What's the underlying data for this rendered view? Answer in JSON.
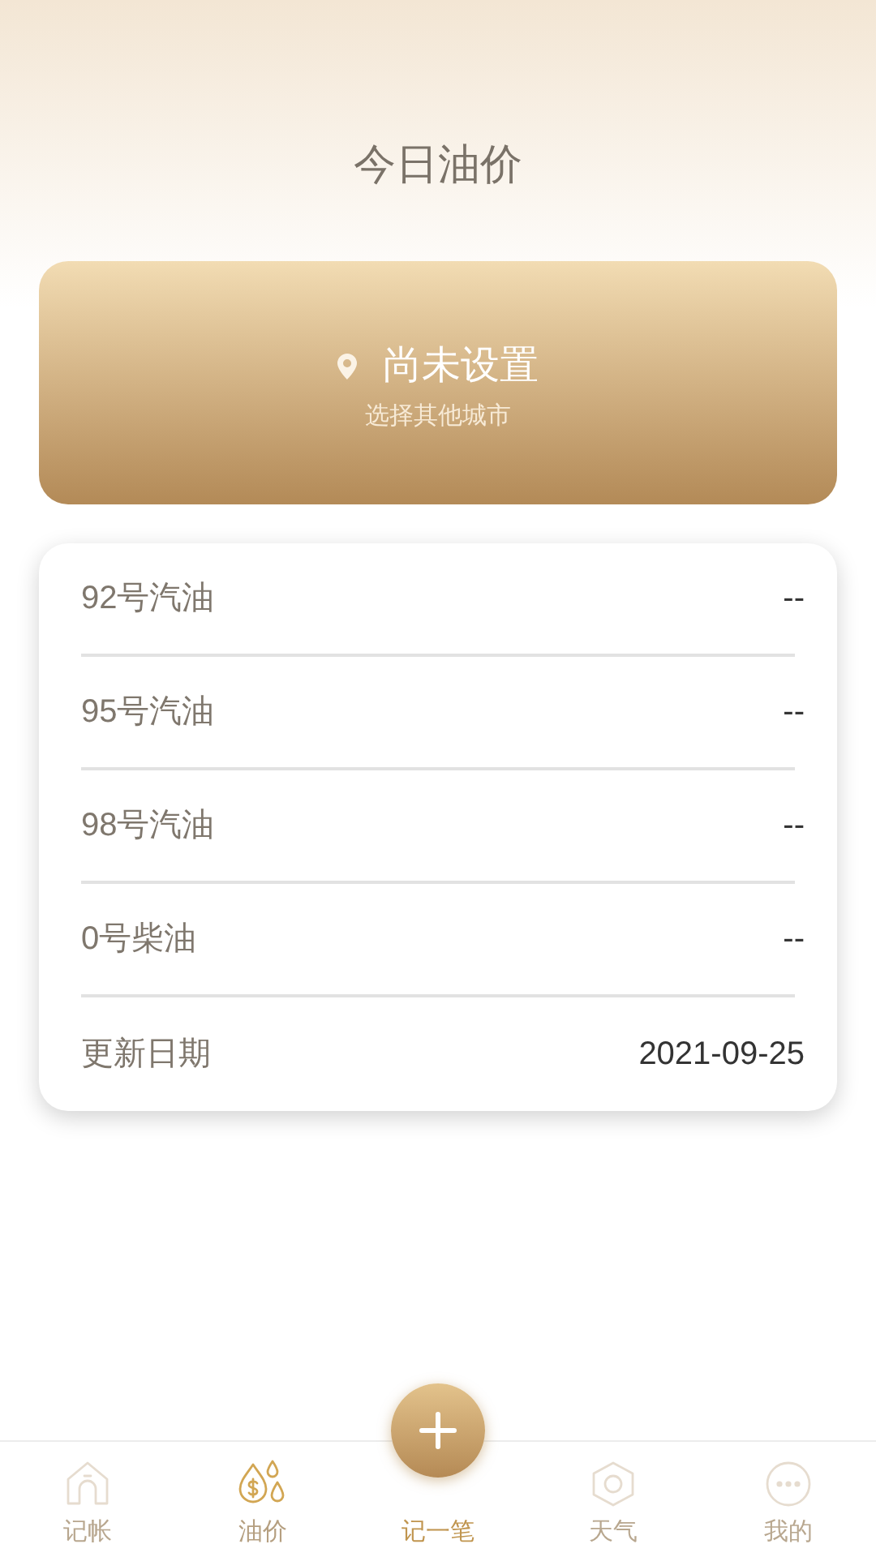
{
  "header": {
    "title": "今日油价"
  },
  "city_card": {
    "city": "尚未设置",
    "hint": "选择其他城市"
  },
  "prices": [
    {
      "label": "92号汽油",
      "value": "--"
    },
    {
      "label": "95号汽油",
      "value": "--"
    },
    {
      "label": "98号汽油",
      "value": "--"
    },
    {
      "label": "0号柴油",
      "value": "--"
    },
    {
      "label": "更新日期",
      "value": "2021-09-25"
    }
  ],
  "tab_bar": [
    {
      "kind": "home",
      "label": "记帐",
      "selected": false
    },
    {
      "kind": "oil",
      "label": "油价",
      "selected": true
    },
    {
      "kind": "add",
      "label": "记一笔",
      "selected": false
    },
    {
      "kind": "weather",
      "label": "天气",
      "selected": false
    },
    {
      "kind": "more",
      "label": "我的",
      "selected": false
    }
  ]
}
